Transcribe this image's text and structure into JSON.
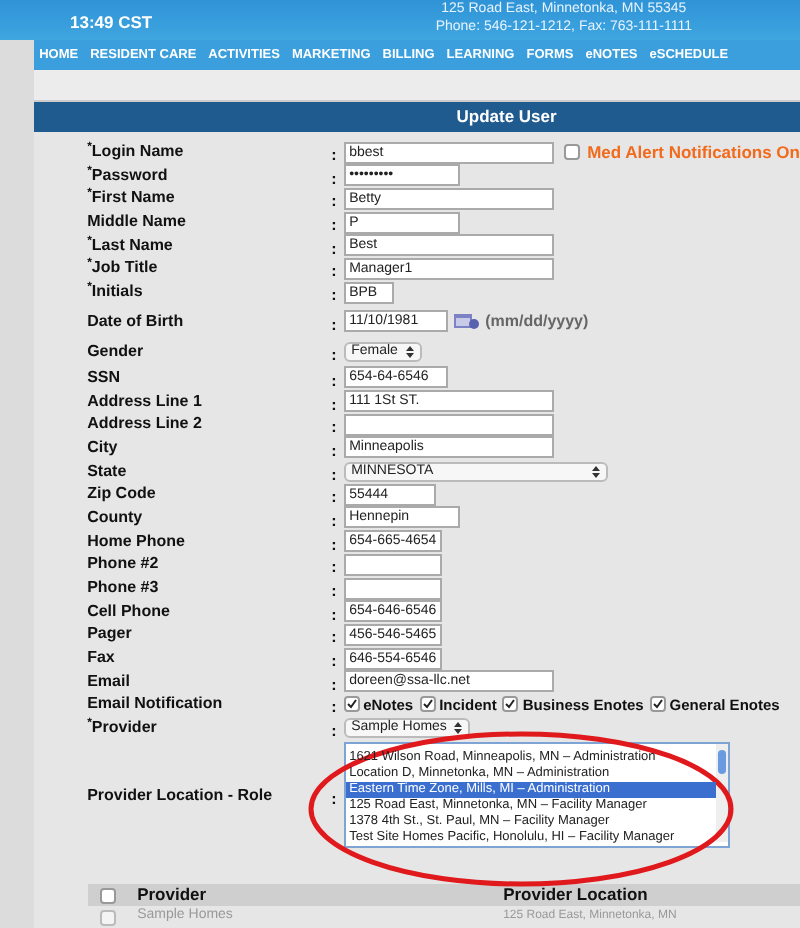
{
  "header": {
    "time": "13:49 CST",
    "address": "125 Road East, Minnetonka, MN 55345",
    "phones": "Phone: 546-121-1212, Fax: 763-111-1111"
  },
  "nav": [
    "HOME",
    "RESIDENT CARE",
    "ACTIVITIES",
    "MARKETING",
    "BILLING",
    "LEARNING",
    "FORMS",
    "eNOTES",
    "eSCHEDULE"
  ],
  "form_title": "Update User",
  "fields": [
    {
      "kind": "text",
      "label": "$^{*}$Login Name",
      "colon": ":",
      "value": "bbest",
      "extra": {
        "label": "Med Alert Notifications On",
        "checked": false
      }
    },
    {
      "kind": "password",
      "label": "$^{*}$Password",
      "colon": ":",
      "value": "•••••••••"
    },
    {
      "kind": "text",
      "label": "$^{*}$First Name",
      "colon": ":",
      "value": "Betty"
    },
    {
      "kind": "text",
      "label": "Middle Name",
      "colon": ":",
      "value": "P"
    },
    {
      "kind": "text",
      "label": "$^{*}$Last Name",
      "colon": ":",
      "value": "Best"
    },
    {
      "kind": "text",
      "label": "$^{*}$Job Title",
      "colon": ":",
      "value": "Manager1"
    },
    {
      "kind": "text",
      "label": "$^{*}$Initials",
      "colon": ":",
      "value": "BPB"
    },
    {
      "kind": "date",
      "label": "Date of Birth",
      "colon": ":",
      "value": "11/10/1981",
      "hint": "(mm/dd/yyyy)"
    },
    {
      "kind": "select",
      "label": "Gender",
      "colon": ":",
      "value": "Female"
    },
    {
      "kind": "text",
      "label": "SSN",
      "colon": ":",
      "value": "654-64-6546"
    },
    {
      "kind": "text",
      "label": "Address Line 1",
      "colon": ":",
      "value": "111 1St ST."
    },
    {
      "kind": "text",
      "label": "Address Line 2",
      "colon": ":"
    },
    {
      "kind": "text",
      "label": "City",
      "colon": ":",
      "value": "Minneapolis"
    },
    {
      "kind": "select",
      "label": "State",
      "colon": ":",
      "value": "MINNESOTA"
    },
    {
      "kind": "text",
      "label": "Zip Code",
      "colon": ":",
      "value": "55444"
    },
    {
      "kind": "text",
      "label": "County",
      "colon": ":",
      "value": "Hennepin"
    },
    {
      "kind": "text",
      "label": "Home Phone",
      "colon": ":",
      "value": "654-665-4654"
    },
    {
      "kind": "text",
      "label": "Phone #2",
      "colon": ":"
    },
    {
      "kind": "text",
      "label": "Phone #3",
      "colon": ":"
    },
    {
      "kind": "text",
      "label": "Cell Phone",
      "colon": ":",
      "value": "654-646-6546"
    },
    {
      "kind": "text",
      "label": "Pager",
      "colon": ":",
      "value": "456-546-5465"
    },
    {
      "kind": "text",
      "label": "Fax",
      "colon": ":",
      "value": "646-554-6546"
    },
    {
      "kind": "text",
      "label": "Email",
      "colon": ":",
      "value": "doreen@ssa-llc.net"
    },
    {
      "kind": "checks",
      "label": "Email Notification",
      "colon": ":",
      "options": [
        {
          "label": "eNotes",
          "checked": true
        },
        {
          "label": "Incident",
          "checked": true
        },
        {
          "label": "Business Enotes",
          "checked": true
        },
        {
          "label": "General Enotes",
          "checked": true
        }
      ]
    },
    {
      "kind": "select",
      "label": "$^{*}$Provider",
      "colon": ":",
      "value": "Sample Homes"
    },
    {
      "kind": "listbox",
      "label": "Provider Location - Role",
      "colon": ":",
      "options": [
        {
          "label": "1621 Wilson Road, Minneapolis, MN – Administration",
          "selected": false
        },
        {
          "label": "Location D, Minnetonka, MN – Administration",
          "selected": false
        },
        {
          "label": "Eastern Time Zone, Mills, MI – Administration",
          "selected": true
        },
        {
          "label": "125 Road East, Minnetonka, MN – Facility Manager",
          "selected": false
        },
        {
          "label": "1378 4th St., St. Paul, MN – Facility Manager",
          "selected": false
        },
        {
          "label": "Test Site Homes Pacific, Honolulu, HI – Facility Manager",
          "selected": false
        }
      ]
    }
  ],
  "table": {
    "columns": [
      "Provider",
      "Provider Location"
    ],
    "header_checked": false,
    "rows": [
      {
        "checked": false,
        "disabled": true,
        "cells": [
          "Sample Homes",
          "125 Road East, Minnetonka, MN"
        ]
      }
    ]
  }
}
